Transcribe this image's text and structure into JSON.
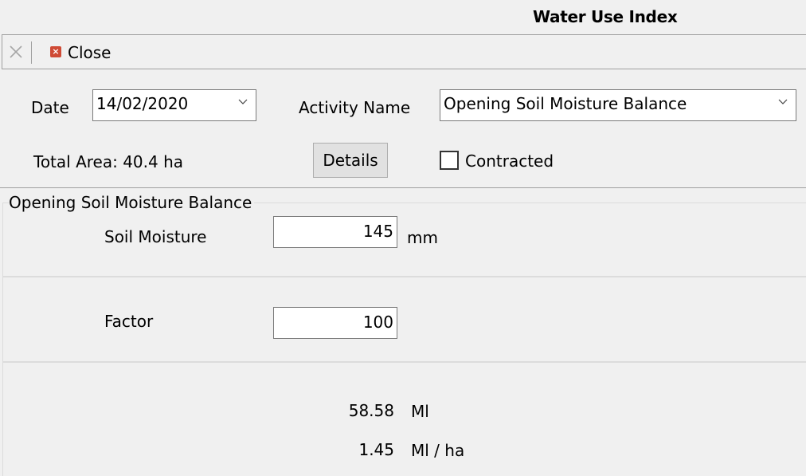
{
  "window": {
    "title": "Water Use Index"
  },
  "toolbar": {
    "close_label": "Close"
  },
  "header": {
    "date_label": "Date",
    "date_value": "14/02/2020",
    "activity_label": "Activity Name",
    "activity_value": "Opening Soil Moisture Balance",
    "total_area_label": "Total Area: 40.4 ha",
    "details_label": "Details",
    "contracted_label": "Contracted",
    "contracted_checked": false
  },
  "group": {
    "title": "Opening Soil Moisture Balance",
    "soil_moisture_label": "Soil Moisture",
    "soil_moisture_value": "145",
    "soil_moisture_unit": "mm",
    "factor_label": "Factor",
    "factor_value": "100",
    "total_volume_value": "58.58",
    "total_volume_unit": "Ml",
    "per_ha_value": "1.45",
    "per_ha_unit": "Ml / ha"
  },
  "colors": {
    "close_icon": "#cf4a35",
    "background": "#f0f0f0"
  }
}
